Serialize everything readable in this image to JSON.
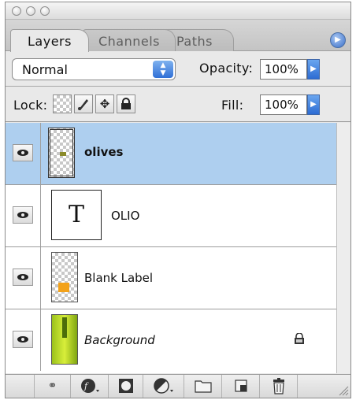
{
  "window": {
    "controls": [
      "close",
      "minimize",
      "zoom"
    ]
  },
  "tabs": [
    {
      "label": "Layers",
      "active": true
    },
    {
      "label": "Channels",
      "active": false
    },
    {
      "label": "Paths",
      "active": false
    }
  ],
  "panel_menu_icon": "panel-menu-icon",
  "blend": {
    "mode": "Normal",
    "opacity_label": "Opacity:",
    "opacity_value": "100%"
  },
  "lock": {
    "label": "Lock:",
    "options": [
      "lock-transparency-icon",
      "lock-image-pixels-icon",
      "lock-position-icon",
      "lock-all-icon"
    ],
    "fill_label": "Fill:",
    "fill_value": "100%"
  },
  "layers": [
    {
      "name": "olives",
      "visible": true,
      "selected": true,
      "type": "image",
      "locked": false
    },
    {
      "name": "OLIO",
      "visible": true,
      "selected": false,
      "type": "text",
      "thumb_text": "T",
      "locked": false
    },
    {
      "name": "Blank Label",
      "visible": true,
      "selected": false,
      "type": "image",
      "locked": false
    },
    {
      "name": "Background",
      "visible": true,
      "selected": false,
      "type": "image",
      "locked": true
    }
  ],
  "bottom_buttons": [
    "link-layers-icon",
    "layer-style-icon",
    "layer-mask-icon",
    "adjustment-layer-icon",
    "new-group-icon",
    "new-layer-icon",
    "delete-layer-icon"
  ],
  "colors": {
    "selection": "#aecfef",
    "accent_blue": "#2f6fd6"
  }
}
